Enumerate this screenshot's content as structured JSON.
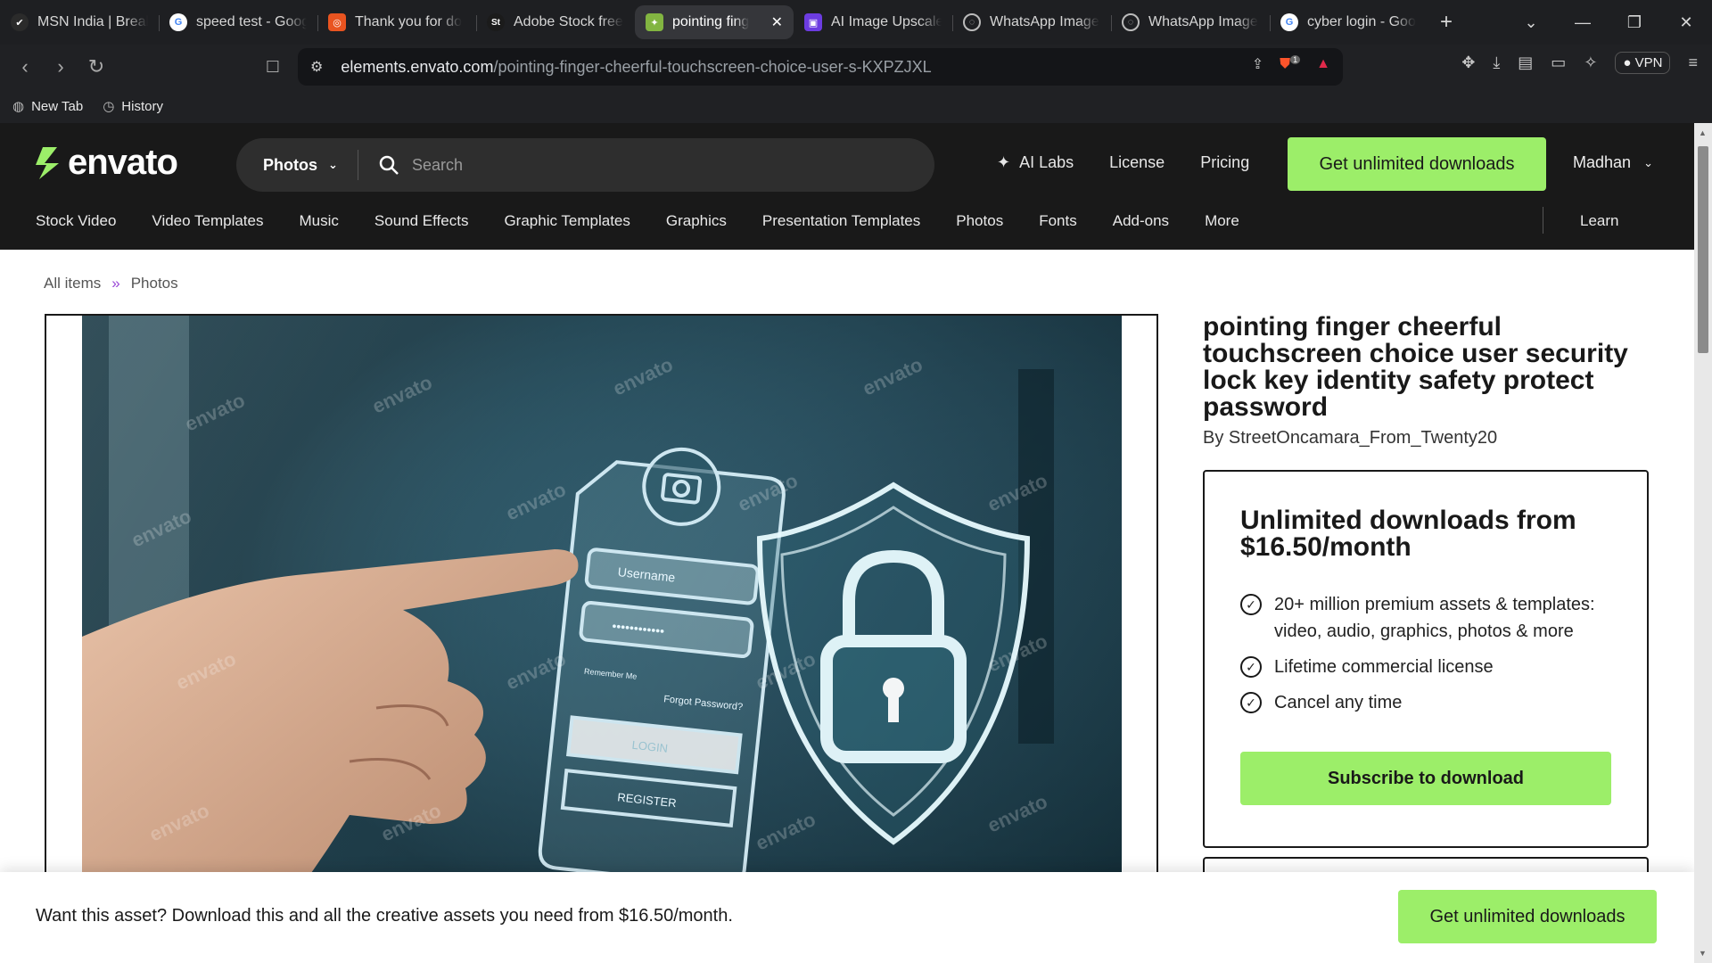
{
  "browser": {
    "tabs": [
      {
        "label": "MSN India | Break",
        "icon": "msn-icon",
        "color": "#2b2b2b"
      },
      {
        "label": "speed test - Goog",
        "icon": "google-icon",
        "color": "#ffffff"
      },
      {
        "label": "Thank you for do",
        "icon": "ubuntu-icon",
        "color": "#e95420"
      },
      {
        "label": "Adobe Stock free",
        "icon": "adobe-stock-icon",
        "color": "#1b1b1b"
      },
      {
        "label": "pointing fing",
        "icon": "envato-icon",
        "color": "#82b541",
        "active": true
      },
      {
        "label": "AI Image Upscale",
        "icon": "upscale-icon",
        "color": "#6c3ce1"
      },
      {
        "label": "WhatsApp Image",
        "icon": "globe-icon",
        "color": "#777777"
      },
      {
        "label": "WhatsApp Image",
        "icon": "globe-icon",
        "color": "#777777"
      },
      {
        "label": "cyber login - Goo",
        "icon": "google-icon",
        "color": "#ffffff"
      }
    ],
    "url_domain": "elements.envato.com",
    "url_path": "/pointing-finger-cheerful-touchscreen-choice-user-s-KXPZJXL",
    "vpn_label": "VPN",
    "shield_badge": "1",
    "bookmarks": [
      {
        "label": "New Tab"
      },
      {
        "label": "History"
      }
    ]
  },
  "header": {
    "logo_text": "envato",
    "search_category": "Photos",
    "search_placeholder": "Search",
    "links": {
      "ai_labs": "AI Labs",
      "license": "License",
      "pricing": "Pricing"
    },
    "cta_label": "Get unlimited downloads",
    "user_name": "Madhan",
    "categories": [
      "Stock Video",
      "Video Templates",
      "Music",
      "Sound Effects",
      "Graphic Templates",
      "Graphics",
      "Presentation Templates",
      "Photos",
      "Fonts",
      "Add-ons",
      "More"
    ],
    "learn_label": "Learn"
  },
  "breadcrumb": {
    "root": "All items",
    "separator": "»",
    "current": "Photos"
  },
  "preview": {
    "watermark": "envato",
    "username_placeholder": "Username",
    "password_mask": "••••••••••••",
    "remember": "Remember Me",
    "forgot": "Forgot Password?",
    "login": "LOGIN",
    "register": "REGISTER"
  },
  "product": {
    "title": "pointing finger cheerful touchscreen choice user security lock key identity safety protect password",
    "author": "By StreetOncamara_From_Twenty20"
  },
  "pricing_card": {
    "heading": "Unlimited downloads from $16.50/month",
    "features": [
      "20+ million premium assets & templates: video, audio, graphics, photos & more",
      "Lifetime commercial license",
      "Cancel any time"
    ],
    "button": "Subscribe to download"
  },
  "banner": {
    "message": "Want this asset? Download this and all the creative assets you need from $16.50/month.",
    "cta": "Get unlimited downloads"
  },
  "colors": {
    "accent": "#9cee69",
    "header_bg": "#191919",
    "breadcrumb_sep": "#9b49d7"
  }
}
